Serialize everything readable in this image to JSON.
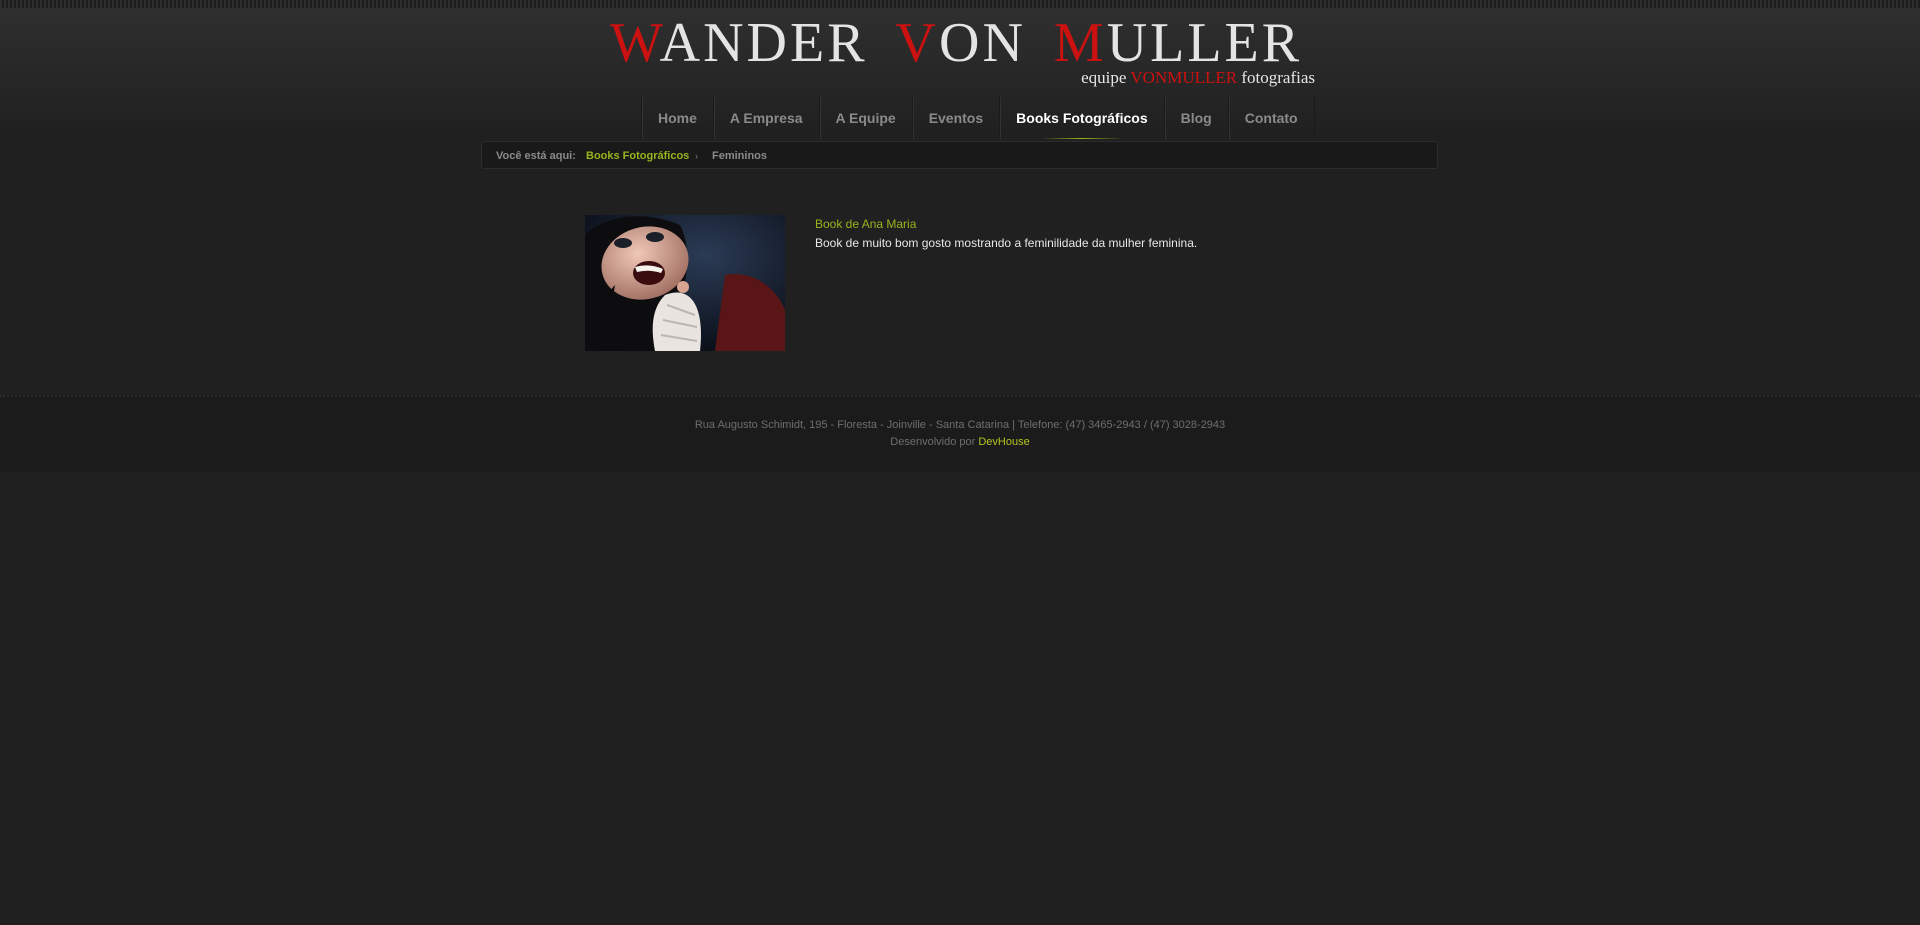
{
  "brand": {
    "title_words": [
      {
        "initial": "W",
        "rest": "ANDER"
      },
      {
        "initial": "V",
        "rest": "ON"
      },
      {
        "initial": "M",
        "rest": "ULLER"
      }
    ],
    "subtitle_prefix": "equipe",
    "subtitle_highlight": "VONMULLER",
    "subtitle_suffix": "fotografias",
    "accent_color": "#cc1111"
  },
  "nav": {
    "items": [
      {
        "label": "Home"
      },
      {
        "label": "A Empresa"
      },
      {
        "label": "A Equipe"
      },
      {
        "label": "Eventos"
      },
      {
        "label": "Books Fotográficos",
        "active": true
      },
      {
        "label": "Blog"
      },
      {
        "label": "Contato"
      }
    ]
  },
  "breadcrumb": {
    "label": "Você está aqui:",
    "parent": "Books Fotográficos",
    "separator": "›",
    "current": "Femininos"
  },
  "items": [
    {
      "title": "Book de Ana Maria",
      "description": "Book de muito bom gosto mostrando a feminilidade da mulher feminina."
    }
  ],
  "footer": {
    "address": "Rua Augusto Schimidt, 195 - Floresta - Joinville - Santa Catarina | Telefone: (47) 3465-2943 / (47) 3028-2943",
    "developed_by_label": "Desenvolvido por",
    "developer": "DevHouse"
  },
  "colors": {
    "link_green": "#97b41c",
    "background": "#202020"
  }
}
